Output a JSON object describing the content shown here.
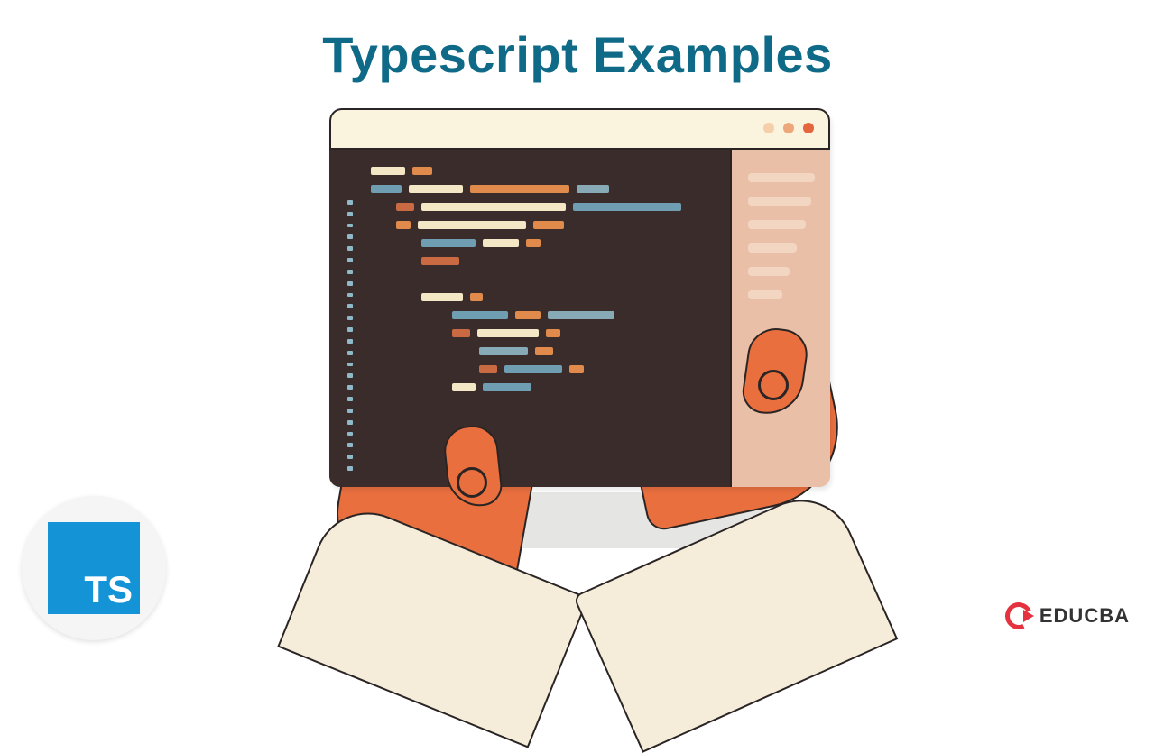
{
  "title": "Typescript Examples",
  "badge": {
    "label": "TS"
  },
  "brand": {
    "name": "EDUCBA"
  },
  "window_dots": [
    "a",
    "b",
    "c"
  ],
  "sidebar_lines": [
    74,
    70,
    64,
    54,
    46,
    38
  ],
  "code_rows": [
    {
      "indent": 0,
      "tokens": [
        [
          "cream",
          38
        ],
        [
          "orange",
          22
        ]
      ]
    },
    {
      "indent": 0,
      "tokens": [
        [
          "blue",
          34
        ],
        [
          "cream",
          60
        ],
        [
          "orange",
          110
        ],
        [
          "steel",
          36
        ]
      ]
    },
    {
      "indent": 1,
      "tokens": [
        [
          "rust",
          20
        ],
        [
          "cream",
          160
        ],
        [
          "blue",
          120
        ]
      ]
    },
    {
      "indent": 1,
      "tokens": [
        [
          "orange",
          16
        ],
        [
          "cream",
          120
        ],
        [
          "orange",
          34
        ]
      ]
    },
    {
      "indent": 2,
      "tokens": [
        [
          "blue",
          60
        ],
        [
          "cream",
          40
        ],
        [
          "orange",
          16
        ]
      ]
    },
    {
      "indent": 2,
      "tokens": [
        [
          "rust",
          42
        ]
      ]
    },
    {
      "indent": 0,
      "tokens": []
    },
    {
      "indent": 2,
      "tokens": [
        [
          "cream",
          46
        ],
        [
          "orange",
          14
        ]
      ]
    },
    {
      "indent": 3,
      "tokens": [
        [
          "blue",
          62
        ],
        [
          "orange",
          28
        ],
        [
          "steel",
          74
        ]
      ]
    },
    {
      "indent": 3,
      "tokens": [
        [
          "rust",
          20
        ],
        [
          "cream",
          68
        ],
        [
          "orange",
          16
        ]
      ]
    },
    {
      "indent": 4,
      "tokens": [
        [
          "steel",
          54
        ],
        [
          "orange",
          20
        ]
      ]
    },
    {
      "indent": 4,
      "tokens": [
        [
          "rust",
          20
        ],
        [
          "blue",
          64
        ],
        [
          "orange",
          16
        ]
      ]
    },
    {
      "indent": 3,
      "tokens": [
        [
          "cream",
          26
        ],
        [
          "blue",
          54
        ]
      ]
    }
  ]
}
